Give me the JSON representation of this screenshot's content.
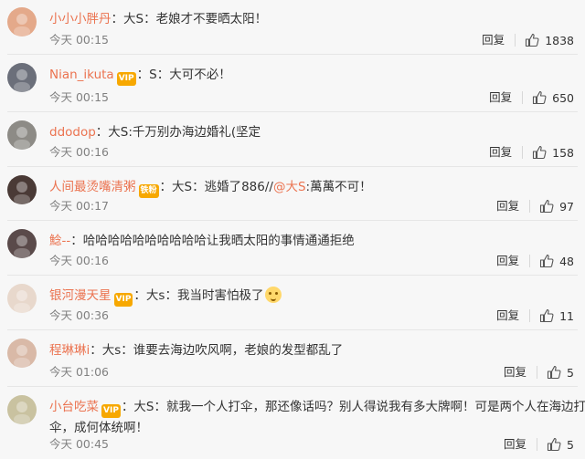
{
  "actions": {
    "reply_label": "回复"
  },
  "comments": [
    {
      "name": "小小小胖丹",
      "badge": "",
      "segments": [
        {
          "t": "：大S：老娘才不要晒太阳！",
          "c": "plain"
        }
      ],
      "emoji": false,
      "time": "今天 00:15",
      "likes": "1838",
      "avatar_color": "#e4a98a"
    },
    {
      "name": "Nian_ikuta",
      "badge": "VIP",
      "segments": [
        {
          "t": "：S：大可不必！",
          "c": "plain"
        }
      ],
      "emoji": false,
      "time": "今天 00:15",
      "likes": "650",
      "avatar_color": "#6b6f7a"
    },
    {
      "name": "ddodop",
      "badge": "",
      "segments": [
        {
          "t": "：大S:千万别办海边婚礼(坚定",
          "c": "plain"
        }
      ],
      "emoji": false,
      "time": "今天 00:16",
      "likes": "158",
      "avatar_color": "#8d8b86"
    },
    {
      "name": "人间最烫嘴清粥",
      "badge": "铁粉",
      "segments": [
        {
          "t": "：大S：逃婚了886//",
          "c": "plain"
        },
        {
          "t": "@大S",
          "c": "mention"
        },
        {
          "t": ":萬萬不可！",
          "c": "plain"
        }
      ],
      "emoji": false,
      "time": "今天 00:17",
      "likes": "97",
      "avatar_color": "#4a3a36"
    },
    {
      "name": "鯰--",
      "badge": "",
      "segments": [
        {
          "t": "：哈哈哈哈哈哈哈哈哈哈让我晒太阳的事情通通拒绝",
          "c": "plain"
        }
      ],
      "emoji": false,
      "time": "今天 00:16",
      "likes": "48",
      "avatar_color": "#5a4a4a"
    },
    {
      "name": "银河漫天星",
      "badge": "VIP",
      "segments": [
        {
          "t": "：大s：我当时害怕极了",
          "c": "plain"
        }
      ],
      "emoji": true,
      "time": "今天 00:36",
      "likes": "11",
      "avatar_color": "#e8d8cc"
    },
    {
      "name": "程琳琳i",
      "badge": "",
      "segments": [
        {
          "t": "：大s：谁要去海边吹风啊，老娘的发型都乱了",
          "c": "plain"
        }
      ],
      "emoji": false,
      "time": "今天 01:06",
      "likes": "5",
      "avatar_color": "#d9b9a7"
    },
    {
      "name": "小台吃菜",
      "badge": "VIP",
      "segments": [
        {
          "t": "：大S：就我一个人打伞，那还像话吗？别人得说我有多大牌啊！可是两个人在海边打",
          "c": "plain"
        }
      ],
      "text2": "伞，成何体统啊！",
      "emoji": false,
      "time": "今天 00:45",
      "likes": "5",
      "avatar_color": "#c9c2a0"
    }
  ]
}
